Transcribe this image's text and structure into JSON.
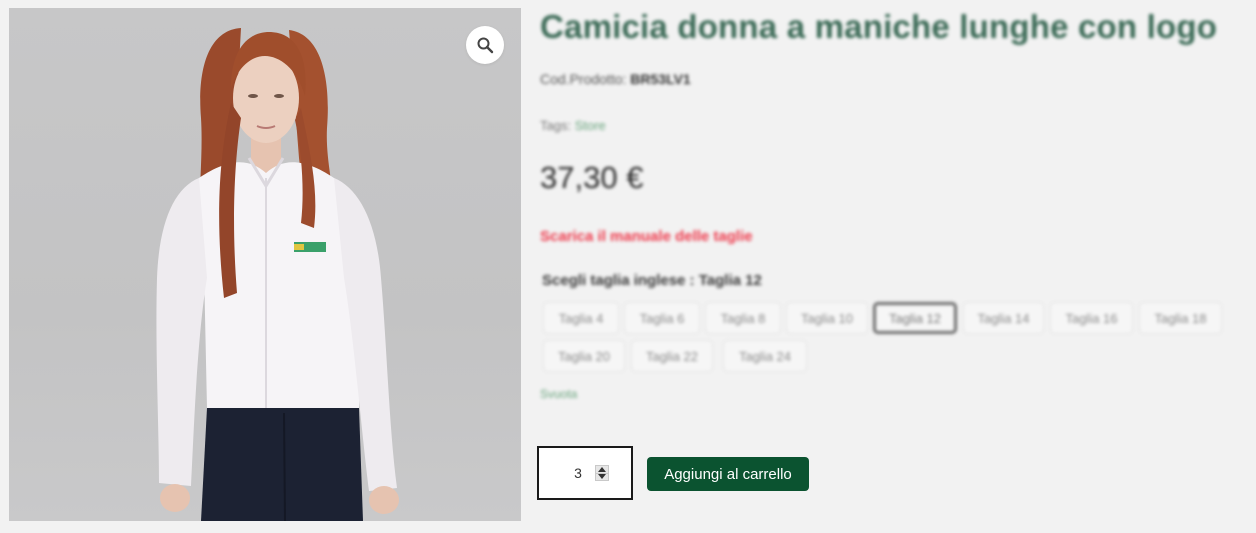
{
  "product": {
    "title": "Camicia donna a maniche lunghe con logo",
    "sku_label": "Cod.Prodotto:",
    "sku_value": "BR53LV1",
    "tags_label": "Tags:",
    "tags_value": "Store",
    "price": "37,30 €",
    "size_guide_link": "Scarica il manuale delle taglie",
    "size_label": "Scegli taglia inglese : Taglia 12",
    "sizes": [
      "Taglia 4",
      "Taglia 6",
      "Taglia 8",
      "Taglia 10",
      "Taglia 12",
      "Taglia 14",
      "Taglia 16",
      "Taglia 18",
      "Taglia 20",
      "Taglia 22",
      "Taglia 24"
    ],
    "selected_size": "Taglia 12",
    "reset_link": "Svuota"
  },
  "cart": {
    "quantity": "3",
    "add_button": "Aggiungi al carrello"
  },
  "icons": {
    "zoom": "magnifier-icon",
    "quantity_up": "spin-up-icon",
    "quantity_down": "spin-down-icon"
  },
  "colors": {
    "title": "#3c6b57",
    "link_red": "#ee3a4c",
    "link_green": "#6aa57e",
    "button": "#0b5330",
    "background": "#f2f2f2"
  }
}
